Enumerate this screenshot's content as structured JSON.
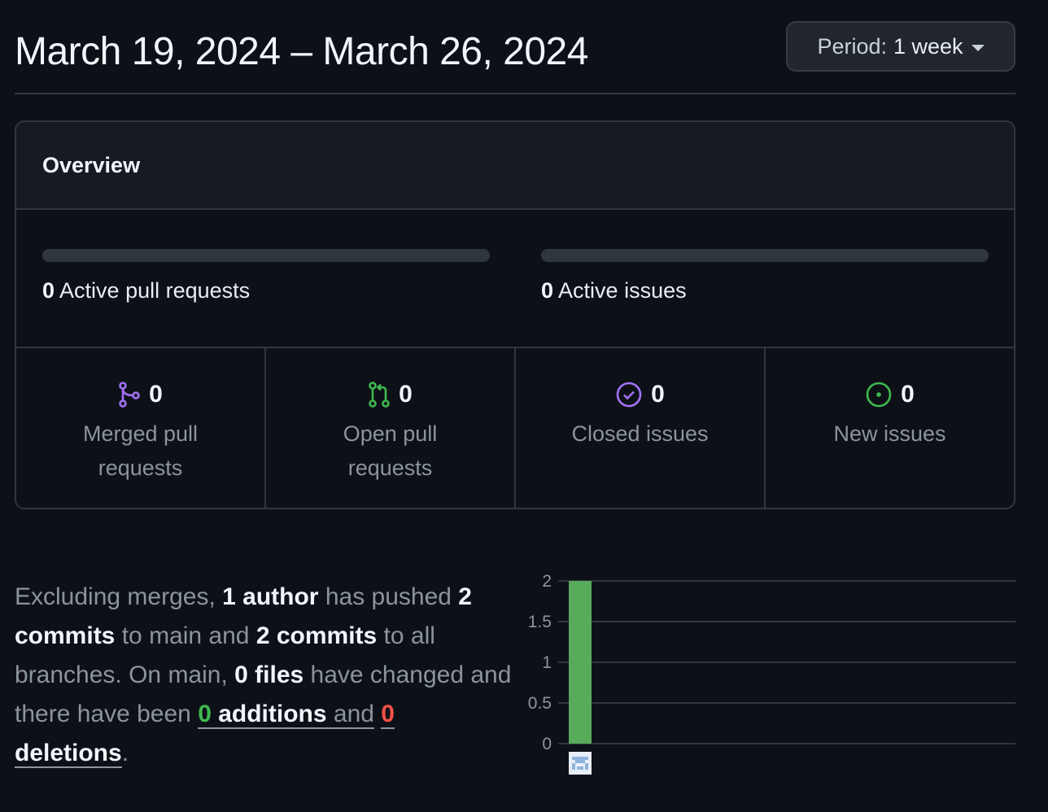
{
  "header": {
    "date_range": "March 19, 2024 – March 26, 2024",
    "period_button": {
      "prefix": "Period:",
      "value": "1 week"
    }
  },
  "overview": {
    "title": "Overview",
    "active_pull_requests": {
      "count": "0",
      "label": "Active pull requests",
      "progress": 0
    },
    "active_issues": {
      "count": "0",
      "label": "Active issues",
      "progress": 0
    },
    "stats": [
      {
        "value": "0",
        "label": "Merged pull requests",
        "icon": "git-merge-icon",
        "color": "#a371f7"
      },
      {
        "value": "0",
        "label": "Open pull requests",
        "icon": "git-pull-request-icon",
        "color": "#3fb950"
      },
      {
        "value": "0",
        "label": "Closed issues",
        "icon": "issue-closed-icon",
        "color": "#a371f7"
      },
      {
        "value": "0",
        "label": "New issues",
        "icon": "issue-opened-icon",
        "color": "#3fb950"
      }
    ]
  },
  "summary": {
    "p1": "Excluding merges, ",
    "authors": "1 author",
    "p2": " has pushed ",
    "commits_main": "2 commits",
    "p3": " to main and ",
    "commits_all": "2 commits",
    "p4": " to all branches. On main, ",
    "files": "0 files",
    "p5": " have changed and there have been ",
    "additions_count": "0",
    "additions_word": " additions",
    "p6": " and",
    "deletions_count": "0",
    "deletions_word": " deletions",
    "p7": "."
  },
  "colors": {
    "bar": "#57ab5a",
    "additions": "#3fb950",
    "deletions": "#f85149"
  },
  "chart_data": {
    "type": "bar",
    "categories": [
      "contributor avatar"
    ],
    "values": [
      2
    ],
    "ylim": [
      0,
      2
    ],
    "yticks": [
      "0",
      "0.5",
      "1",
      "1.5",
      "2"
    ],
    "grid": true
  }
}
